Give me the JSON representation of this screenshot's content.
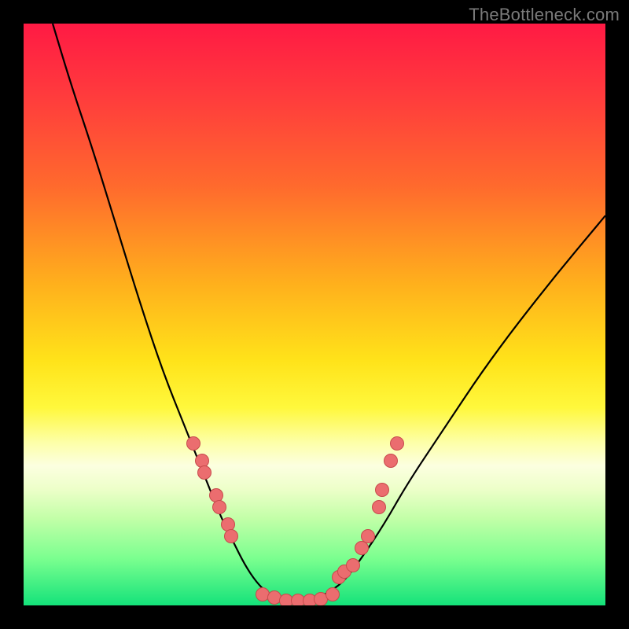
{
  "watermark": "TheBottleneck.com",
  "colors": {
    "gradient_top": "#ff1a44",
    "gradient_bottom": "#14e27a",
    "curve": "#000000",
    "dot_fill": "#eb6d6f",
    "dot_border": "#c74a4c",
    "frame": "#000000"
  },
  "chart_data": {
    "type": "line",
    "title": "",
    "xlabel": "",
    "ylabel": "",
    "xlim": [
      0,
      100
    ],
    "ylim": [
      0,
      100
    ],
    "grid": false,
    "legend": false,
    "curve": {
      "name": "bottleneck-curve",
      "x": [
        5,
        8,
        12,
        16,
        20,
        24,
        28,
        32,
        34,
        36,
        38,
        40,
        42,
        45,
        48,
        50,
        52,
        55,
        58,
        62,
        66,
        72,
        80,
        90,
        100
      ],
      "y": [
        100,
        90,
        78,
        65,
        52,
        40,
        30,
        20,
        15,
        11,
        7,
        4,
        2,
        1,
        1,
        1,
        2,
        4,
        8,
        14,
        21,
        30,
        42,
        55,
        67
      ]
    },
    "series": [
      {
        "name": "left-arm-dots",
        "x": [
          29,
          30.5,
          31,
          33,
          33.5,
          35,
          35.5
        ],
        "y": [
          28,
          25,
          23,
          19,
          17,
          14,
          12
        ]
      },
      {
        "name": "valley-dots",
        "x": [
          41,
          43,
          45,
          47,
          49,
          51,
          53
        ],
        "y": [
          2,
          1.5,
          1,
          1,
          1,
          1.2,
          2
        ]
      },
      {
        "name": "right-arm-dots",
        "x": [
          54,
          55,
          56.5,
          58,
          59,
          61,
          61.5,
          63,
          64
        ],
        "y": [
          5,
          6,
          7,
          10,
          12,
          17,
          20,
          25,
          28
        ]
      }
    ]
  }
}
